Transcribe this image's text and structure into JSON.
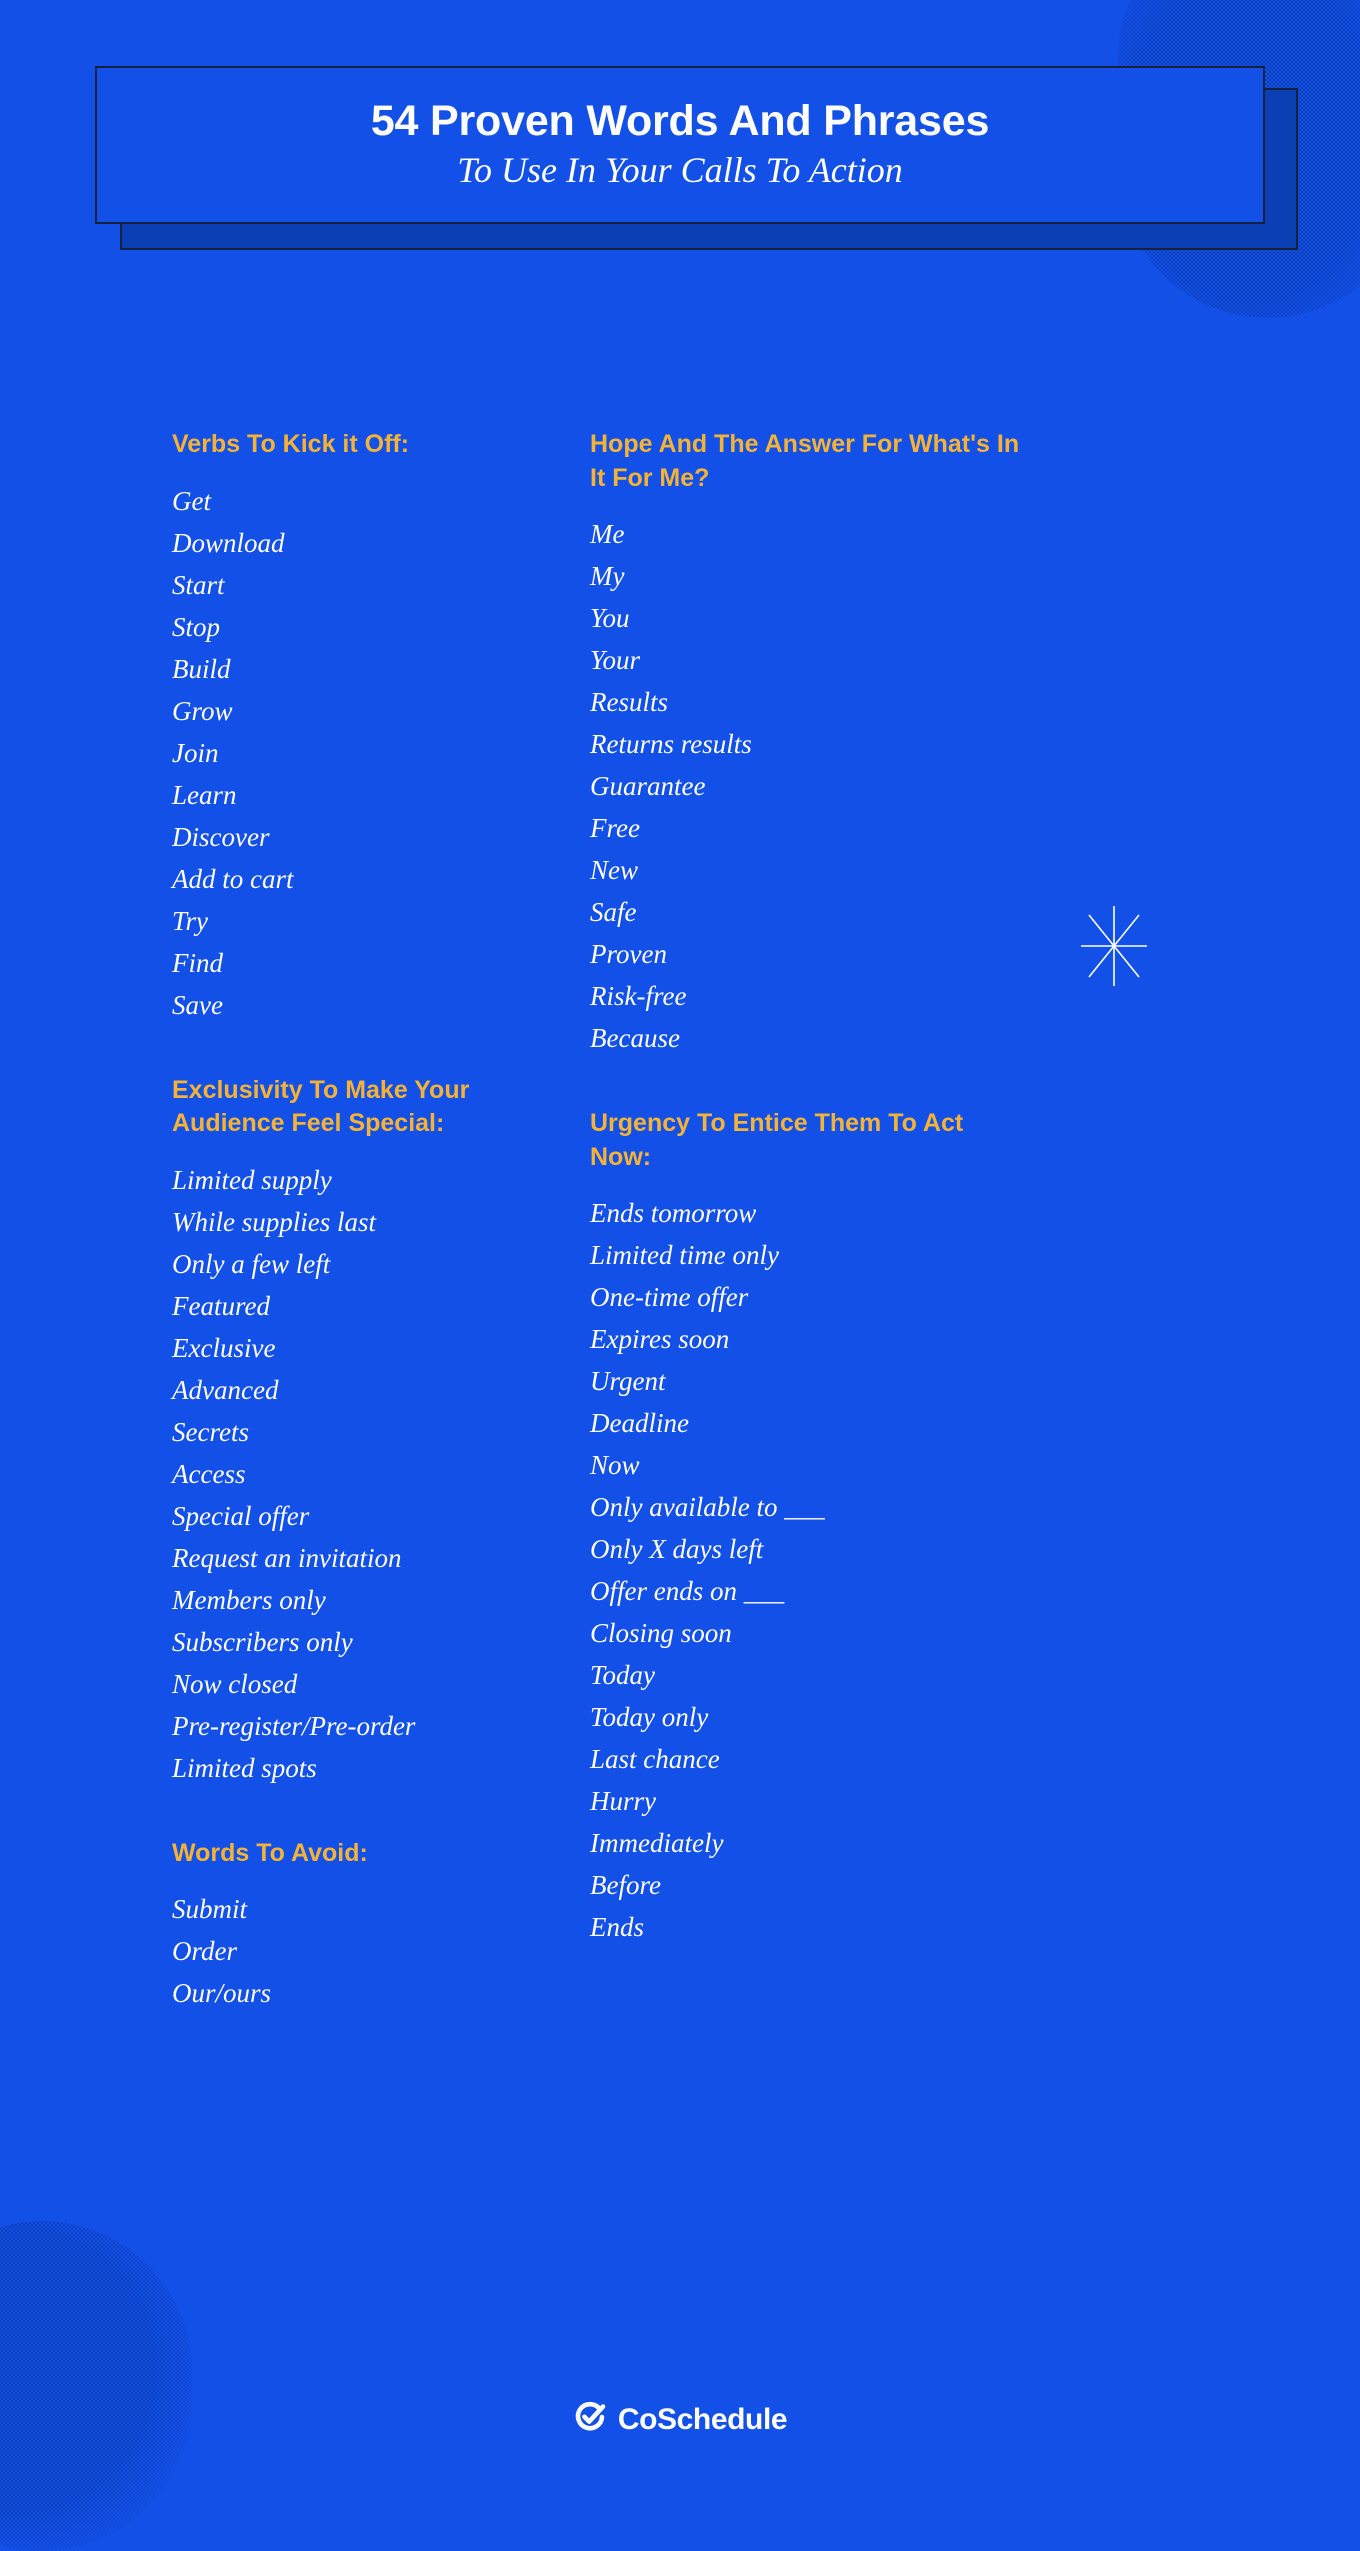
{
  "colors": {
    "background": "#1350e8",
    "header_shadow": "#0b3fb4",
    "header_border": "#16213f",
    "heading_accent": "#f5b335",
    "body_text": "#ffffff",
    "blob_texture": "#0b3bb0"
  },
  "header": {
    "title": "54 Proven Words And Phrases",
    "subtitle": "To Use In Your Calls To Action"
  },
  "columns": {
    "left": [
      {
        "heading": "Verbs To Kick it Off:",
        "items": [
          "Get",
          "Download",
          "Start",
          "Stop",
          "Build",
          "Grow",
          "Join",
          "Learn",
          "Discover",
          "Add to cart",
          "Try",
          "Find",
          "Save"
        ]
      },
      {
        "heading": "Exclusivity To Make Your Audience Feel Special:",
        "items": [
          "Limited supply",
          "While supplies last",
          "Only a few left",
          "Featured",
          "Exclusive",
          "Advanced",
          "Secrets",
          "Access",
          "Special offer",
          "Request an invitation",
          "Members only",
          "Subscribers only",
          "Now closed",
          "Pre-register/Pre-order",
          "Limited spots"
        ]
      },
      {
        "heading": "Words To Avoid:",
        "items": [
          "Submit",
          "Order",
          "Our/ours"
        ]
      }
    ],
    "right": [
      {
        "heading": "Hope And The Answer For What's In It For Me?",
        "items": [
          "Me",
          "My",
          "You",
          "Your",
          "Results",
          "Returns results",
          "Guarantee",
          "Free",
          "New",
          "Safe",
          "Proven",
          "Risk-free",
          "Because"
        ]
      },
      {
        "heading": "Urgency To Entice Them To Act Now:",
        "items": [
          "Ends tomorrow",
          "Limited time only",
          "One-time offer",
          "Expires soon",
          "Urgent",
          "Deadline",
          "Now",
          "Only available to ___",
          "Only X days left",
          "Offer ends on ___",
          "Closing soon",
          "Today",
          "Today only",
          "Last chance",
          "Hurry",
          "Immediately",
          "Before",
          "Ends"
        ]
      }
    ]
  },
  "footer": {
    "brand": "CoSchedule"
  }
}
